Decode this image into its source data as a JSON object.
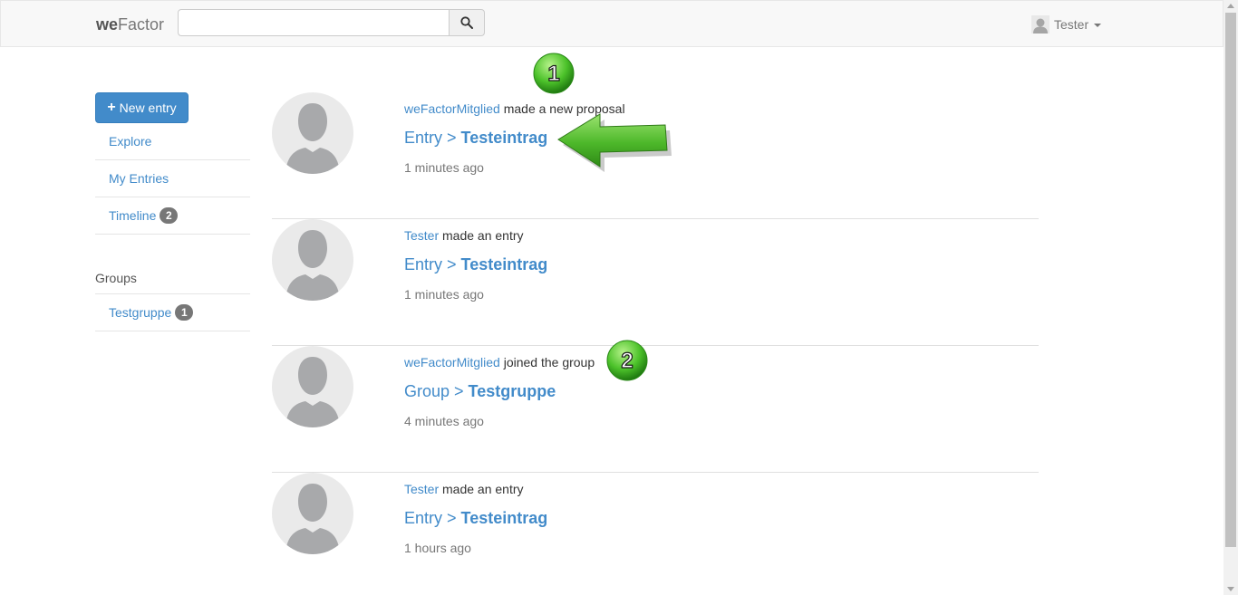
{
  "navbar": {
    "brand_bold": "we",
    "brand_rest": "Factor",
    "search_placeholder": "",
    "user_name": "Tester"
  },
  "sidebar": {
    "new_entry_label": "New entry",
    "items": [
      {
        "label": "Explore"
      },
      {
        "label": "My Entries"
      },
      {
        "label": "Timeline",
        "badge": "2"
      }
    ],
    "groups_title": "Groups",
    "groups": [
      {
        "label": "Testgruppe",
        "badge": "1"
      }
    ]
  },
  "feed": [
    {
      "actor": "weFactorMitglied",
      "action": "made a new proposal",
      "type": "Entry",
      "target": "Testeintrag",
      "time": "1 minutes ago"
    },
    {
      "actor": "Tester",
      "action": "made an entry",
      "type": "Entry",
      "target": "Testeintrag",
      "time": "1 minutes ago"
    },
    {
      "actor": "weFactorMitglied",
      "action": "joined the group",
      "type": "Group",
      "target": "Testgruppe",
      "time": "4 minutes ago"
    },
    {
      "actor": "Tester",
      "action": "made an entry",
      "type": "Entry",
      "target": "Testeintrag",
      "time": "1 hours ago"
    }
  ],
  "annotations": {
    "marker_1": "1",
    "marker_2": "2"
  },
  "colors": {
    "link": "#428bca",
    "primary_button": "#428bca",
    "badge": "#777777",
    "marker_green": "#3cb521"
  }
}
